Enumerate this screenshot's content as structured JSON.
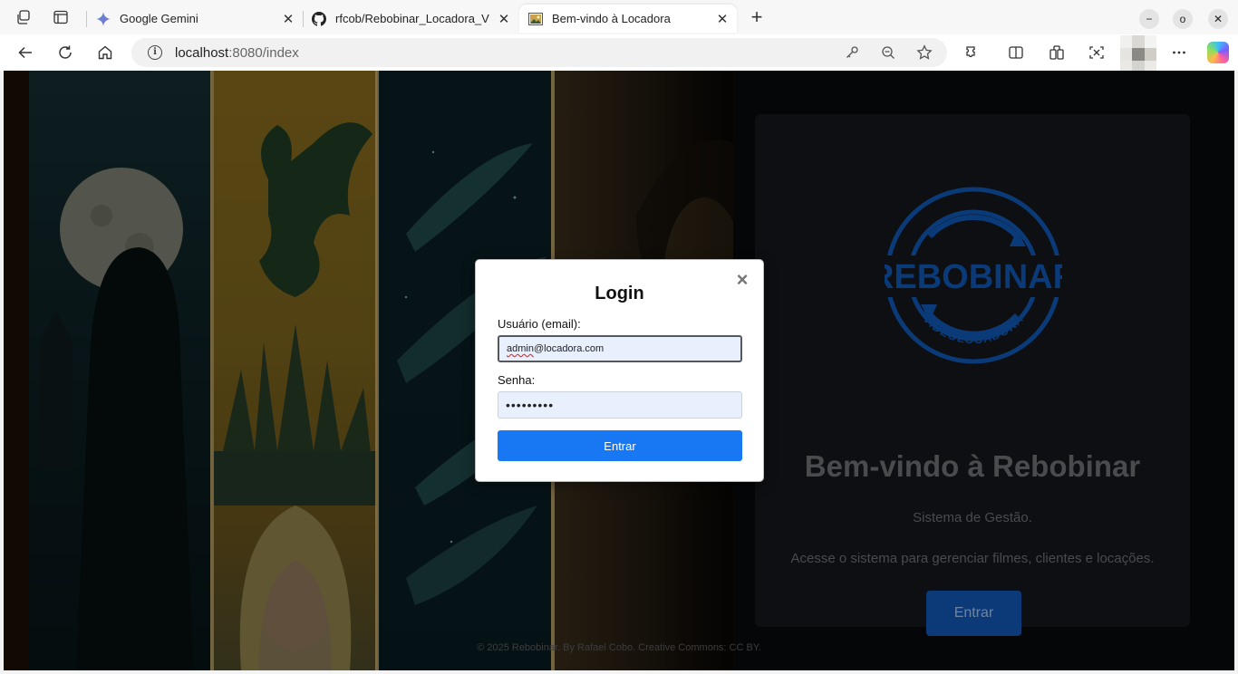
{
  "browser": {
    "tabs": [
      {
        "title": "Google Gemini",
        "favicon": "gemini-icon"
      },
      {
        "title": "rfcob/Rebobinar_Locadora_V",
        "favicon": "github-icon"
      },
      {
        "title": "Bem-vindo à Locadora",
        "favicon": "page-image-icon",
        "active": true
      }
    ],
    "url_host": "localhost",
    "url_path": ":8080/index",
    "window_controls": {
      "minimize": "−",
      "restore": "o",
      "close": "✕"
    }
  },
  "page": {
    "logo_text": "REBOBINAR",
    "logo_subtext": "VIDEOLOCADORA",
    "welcome_title": "Bem-vindo à Rebobinar",
    "subtitle": "Sistema de Gestão.",
    "description": "Acesse o sistema para gerenciar filmes, clientes e locações.",
    "enter_button": "Entrar",
    "footer": "© 2025 Rebobinar. By Rafael Cobo. Creative Commons: CC BY."
  },
  "modal": {
    "title": "Login",
    "close": "×",
    "email_label": "Usuário (email):",
    "email_value_typo": "admin",
    "email_value_rest": "@locadora.com",
    "password_label": "Senha:",
    "password_value": "•••••••••",
    "submit_label": "Entrar"
  },
  "colors": {
    "accent": "#1877f2",
    "logo": "#0b3a78",
    "dragon_gold": "#c9a227",
    "night_teal": "#0f2f36"
  }
}
